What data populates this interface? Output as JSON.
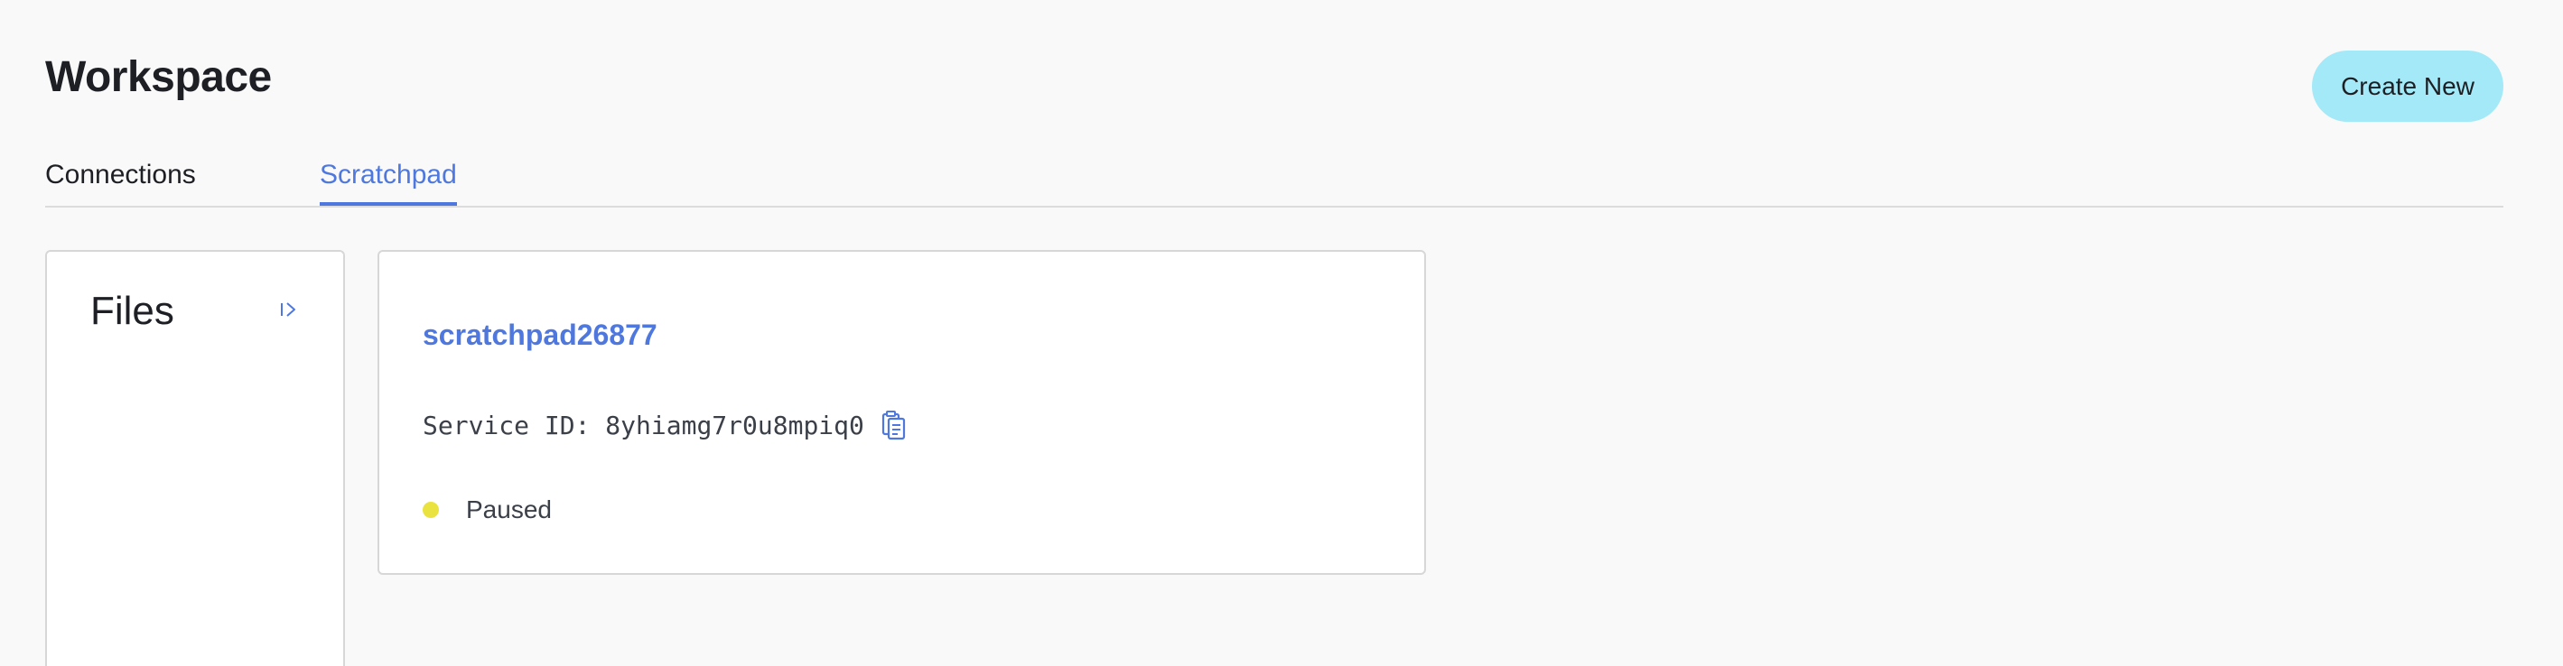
{
  "page": {
    "title": "Workspace",
    "create_button_label": "Create New"
  },
  "tabs": [
    {
      "label": "Connections",
      "active": false
    },
    {
      "label": "Scratchpad",
      "active": true
    }
  ],
  "files_panel": {
    "title": "Files",
    "collapse_icon": "panel-collapse-icon"
  },
  "service": {
    "name": "scratchpad26877",
    "service_id_label": "Service ID:",
    "service_id_value": "8yhiamg7r0u8mpiq0",
    "copy_icon": "copy-icon",
    "status": "Paused",
    "status_color": "#eae33f"
  },
  "colors": {
    "accent": "#4f78de",
    "button_bg": "#a3e9f7",
    "background": "#f9f9f9"
  }
}
